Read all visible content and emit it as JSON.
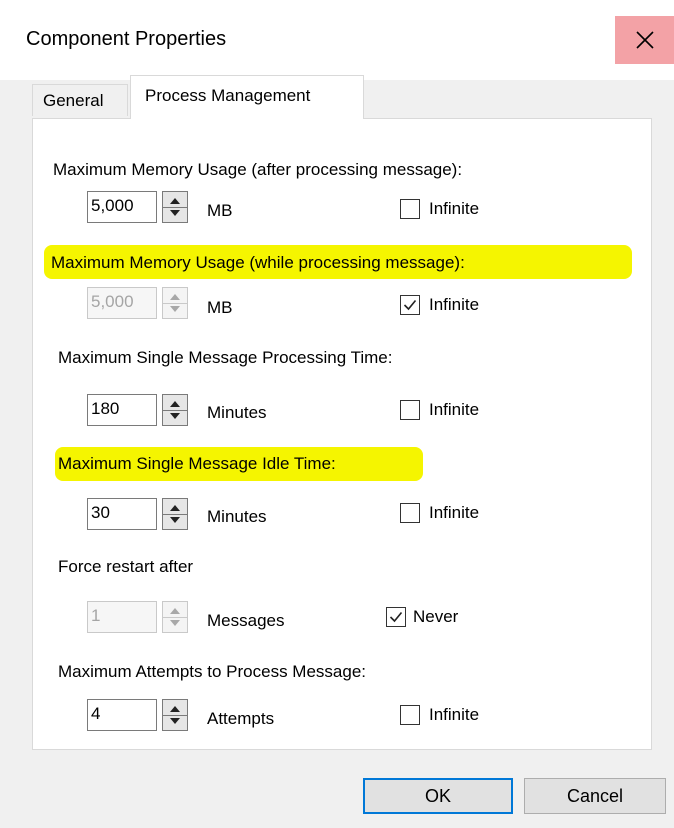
{
  "window": {
    "title": "Component Properties"
  },
  "tabs": [
    {
      "label": "General",
      "active": false
    },
    {
      "label": "Process Management",
      "active": true
    }
  ],
  "sections": {
    "mem_after": {
      "label": "Maximum Memory Usage (after processing message):",
      "value": "5,000",
      "unit": "MB",
      "check_label": "Infinite",
      "checked": false,
      "disabled": false,
      "highlighted": false
    },
    "mem_while": {
      "label": "Maximum Memory Usage (while processing message):",
      "value": "5,000",
      "unit": "MB",
      "check_label": "Infinite",
      "checked": true,
      "disabled": true,
      "highlighted": true
    },
    "proc_time": {
      "label": "Maximum Single Message Processing Time:",
      "value": "180",
      "unit": "Minutes",
      "check_label": "Infinite",
      "checked": false,
      "disabled": false,
      "highlighted": false
    },
    "idle_time": {
      "label": "Maximum Single Message Idle Time:",
      "value": "30",
      "unit": "Minutes",
      "check_label": "Infinite",
      "checked": false,
      "disabled": false,
      "highlighted": true
    },
    "force_restart": {
      "label": "Force restart after",
      "value": "1",
      "unit": "Messages",
      "check_label": "Never",
      "checked": true,
      "disabled": true,
      "highlighted": false
    },
    "attempts": {
      "label": "Maximum Attempts to Process Message:",
      "value": "4",
      "unit": "Attempts",
      "check_label": "Infinite",
      "checked": false,
      "disabled": false,
      "highlighted": false
    }
  },
  "buttons": {
    "ok": "OK",
    "cancel": "Cancel"
  },
  "colors": {
    "highlight": "#f5f500",
    "close_hover": "#f3a2a6",
    "default_button_border": "#0078d7"
  }
}
